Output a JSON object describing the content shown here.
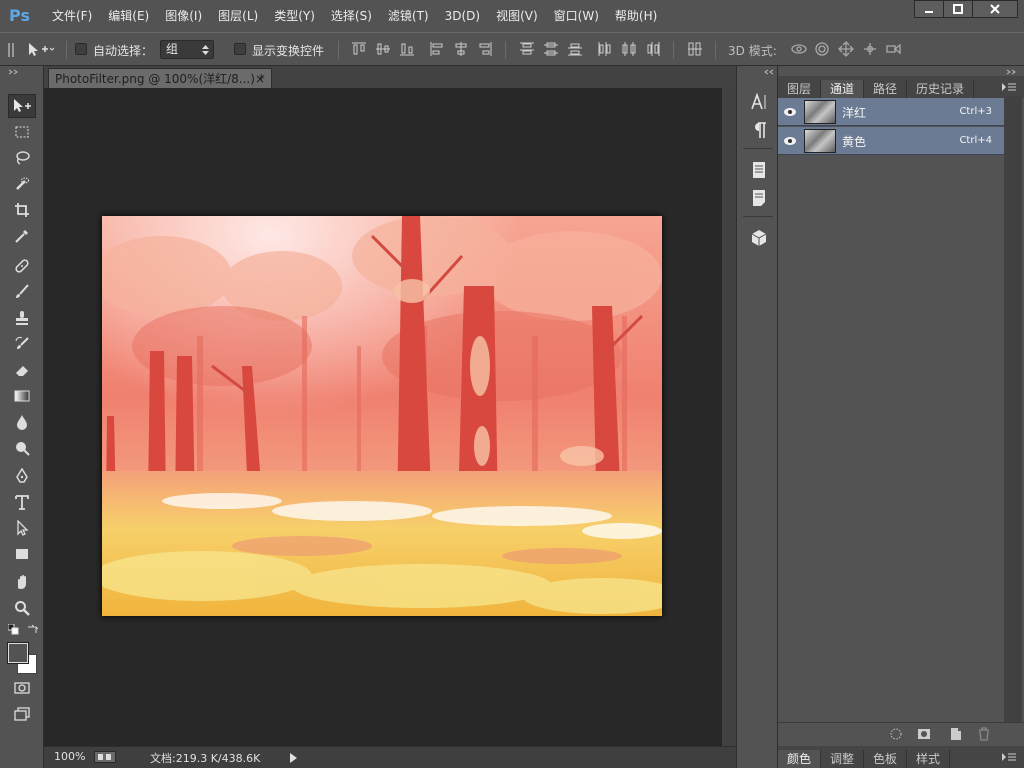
{
  "app": {
    "logo": "Ps"
  },
  "menu": [
    "文件(F)",
    "编辑(E)",
    "图像(I)",
    "图层(L)",
    "类型(Y)",
    "选择(S)",
    "滤镜(T)",
    "3D(D)",
    "视图(V)",
    "窗口(W)",
    "帮助(H)"
  ],
  "options": {
    "auto_select_label": "自动选择：",
    "auto_select_value": "组",
    "transform_label": "显示变换控件",
    "mode_3d_label": "3D 模式:"
  },
  "document": {
    "tab_title": "PhotoFilter.png @ 100%(洋红/8...) *",
    "close_glyph": "×"
  },
  "status": {
    "zoom": "100%",
    "doc_info": "文档:219.3 K/438.6K"
  },
  "panels": {
    "top_tabs": [
      "图层",
      "通道",
      "路径",
      "历史记录"
    ],
    "active_top_tab": "通道",
    "channels": [
      {
        "name": "洋红",
        "shortcut": "Ctrl+3"
      },
      {
        "name": "黄色",
        "shortcut": "Ctrl+4"
      }
    ],
    "bottom_tabs": [
      "颜色",
      "调整",
      "色板",
      "样式"
    ],
    "active_bottom_tab": "颜色"
  },
  "colors": {
    "accent_logo": "#5ea7e6",
    "channel_row": "#6b7b93",
    "canvas_bg": "#282828"
  }
}
